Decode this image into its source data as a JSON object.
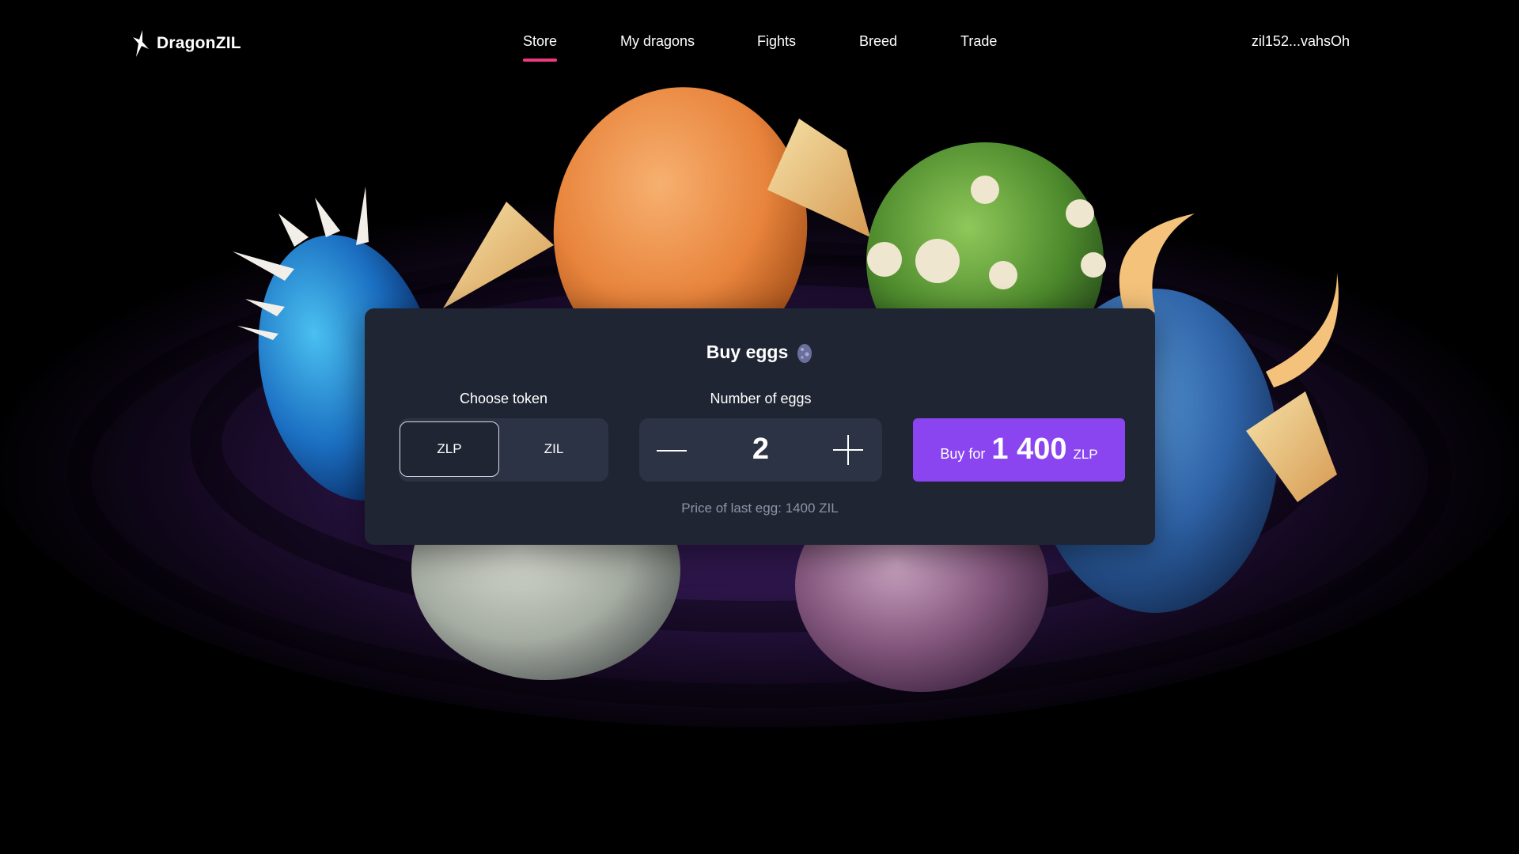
{
  "app": {
    "name": "DragonZIL"
  },
  "nav": {
    "items": [
      {
        "label": "Store",
        "active": true
      },
      {
        "label": "My dragons",
        "active": false
      },
      {
        "label": "Fights",
        "active": false
      },
      {
        "label": "Breed",
        "active": false
      },
      {
        "label": "Trade",
        "active": false
      }
    ],
    "wallet_label": "zil152...vahsOh"
  },
  "buy_panel": {
    "title": "Buy eggs",
    "title_icon": "egg-icon",
    "choose_token_label": "Choose token",
    "tokens": [
      {
        "label": "ZLP",
        "selected": true
      },
      {
        "label": "ZIL",
        "selected": false
      }
    ],
    "number_label": "Number of eggs",
    "count": "2",
    "buy_prefix": "Buy for",
    "buy_amount": "1 400",
    "buy_currency": "ZLP",
    "price_note": "Price of last egg: 1400 ZIL"
  },
  "colors": {
    "accent_purple": "#8a45f0",
    "active_underline": "#ec3b83",
    "panel_bg": "#1f2533",
    "control_bg": "#2c3344"
  }
}
